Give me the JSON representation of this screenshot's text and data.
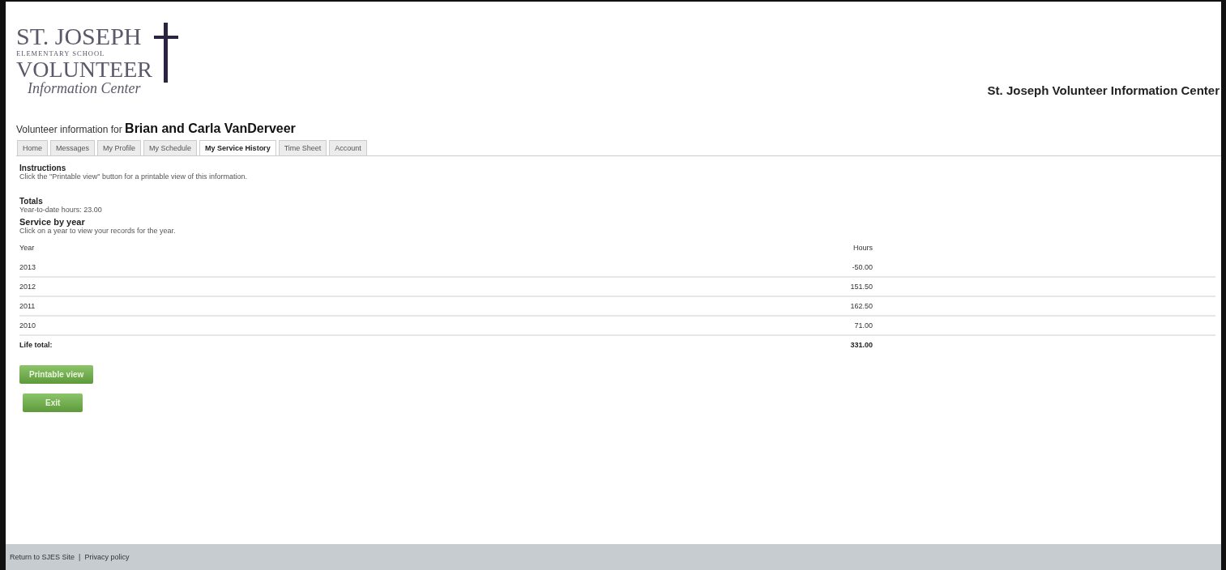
{
  "logo": {
    "line_1": "ST. JOSEPH",
    "line_2": "ELEMENTARY SCHOOL",
    "line_3": "VOLUNTEER",
    "line_4": "Information Center"
  },
  "site_title": "St. Joseph Volunteer Information Center",
  "heading": {
    "prefix": "Volunteer information for",
    "name": "Brian and Carla VanDerveer"
  },
  "tabs": [
    {
      "label": "Home",
      "selected": false
    },
    {
      "label": "Messages",
      "selected": false
    },
    {
      "label": "My Profile",
      "selected": false
    },
    {
      "label": "My Schedule",
      "selected": false
    },
    {
      "label": "My Service History",
      "selected": true
    },
    {
      "label": "Time Sheet",
      "selected": false
    },
    {
      "label": "Account",
      "selected": false
    }
  ],
  "instructions": {
    "title": "Instructions",
    "text": "Click the \"Printable view\" button for a printable view of this information."
  },
  "totals": {
    "title": "Totals",
    "text": "Year-to-date hours: 23.00"
  },
  "service_by_year": {
    "title": "Service by year",
    "text": "Click on a year to view your records for the year.",
    "columns": [
      "Year",
      "Hours"
    ],
    "rows": [
      {
        "year": "2013",
        "hours": "-50.00"
      },
      {
        "year": "2012",
        "hours": "151.50"
      },
      {
        "year": "2011",
        "hours": "162.50"
      },
      {
        "year": "2010",
        "hours": "71.00"
      }
    ],
    "total": {
      "label": "Life total:",
      "hours": "331.00"
    }
  },
  "buttons": [
    "Printable view",
    "Exit"
  ],
  "footer": {
    "links": [
      "Return to SJES Site",
      "Privacy policy"
    ],
    "separator": "|"
  }
}
